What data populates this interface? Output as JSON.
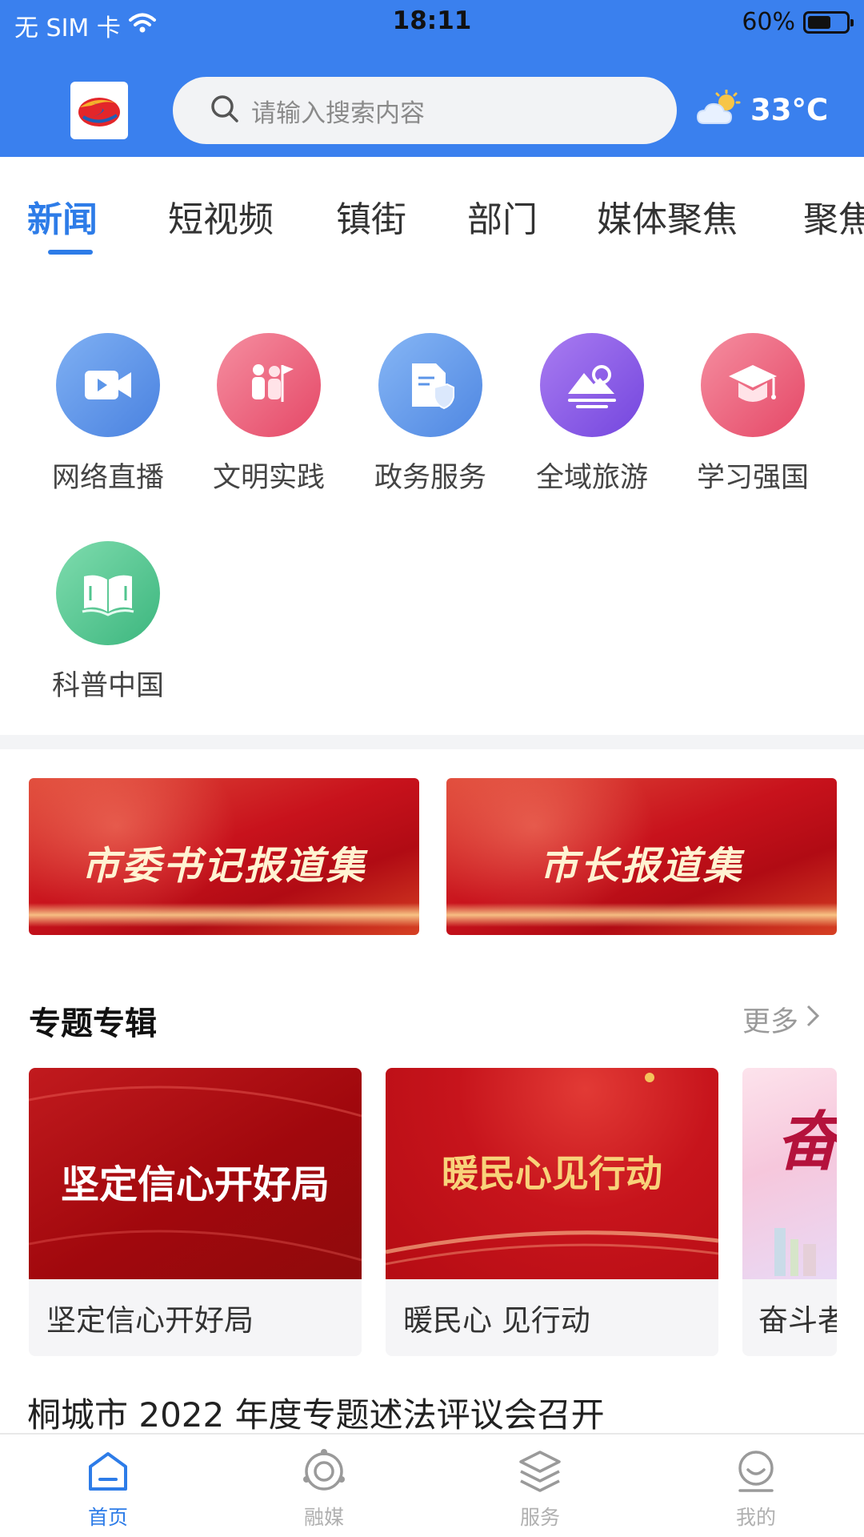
{
  "status_bar": {
    "carrier": "无 SIM 卡",
    "time": "18:11",
    "battery": "60%",
    "battery_level": 0.6
  },
  "header": {
    "search_placeholder": "请输入搜索内容",
    "temperature": "33°C"
  },
  "tabs": [
    {
      "label": "新闻",
      "active": true
    },
    {
      "label": "短视频"
    },
    {
      "label": "镇街"
    },
    {
      "label": "部门"
    },
    {
      "label": "媒体聚焦"
    },
    {
      "label": "聚焦"
    }
  ],
  "quick_icons": [
    {
      "label": "网络直播",
      "icon": "video-icon",
      "color": "#5b95e8"
    },
    {
      "label": "文明实践",
      "icon": "volunteer-flag-icon",
      "color": "#ec5f7c"
    },
    {
      "label": "政务服务",
      "icon": "document-shield-icon",
      "color": "#5b95e8"
    },
    {
      "label": "全域旅游",
      "icon": "landscape-icon",
      "color": "#8a58e6"
    },
    {
      "label": "学习强国",
      "icon": "graduation-cap-icon",
      "color": "#ec5f7c"
    },
    {
      "label": "科普中国",
      "icon": "open-book-icon",
      "color": "#52c58f"
    }
  ],
  "banners": [
    {
      "label": "市委书记报道集"
    },
    {
      "label": "市长报道集"
    }
  ],
  "special_section": {
    "title": "专题专辑",
    "more": "更多"
  },
  "special_cards": [
    {
      "image_text": "坚定信心开好局",
      "label": "坚定信心开好局"
    },
    {
      "image_text": "暖民心见行动",
      "label": "暖民心 见行动"
    },
    {
      "image_text": "奋",
      "label": "奋斗者"
    }
  ],
  "headline": "桐城市 2022 年度专题述法评议会召开",
  "bottom_nav": [
    {
      "label": "首页",
      "icon": "home-icon",
      "active": true
    },
    {
      "label": "融媒",
      "icon": "orbit-icon"
    },
    {
      "label": "服务",
      "icon": "layers-icon"
    },
    {
      "label": "我的",
      "icon": "smile-user-icon"
    }
  ],
  "colors": {
    "primary": "#3a80ee",
    "active_tab": "#2d7ce8",
    "banner_red": "#c8121c"
  }
}
